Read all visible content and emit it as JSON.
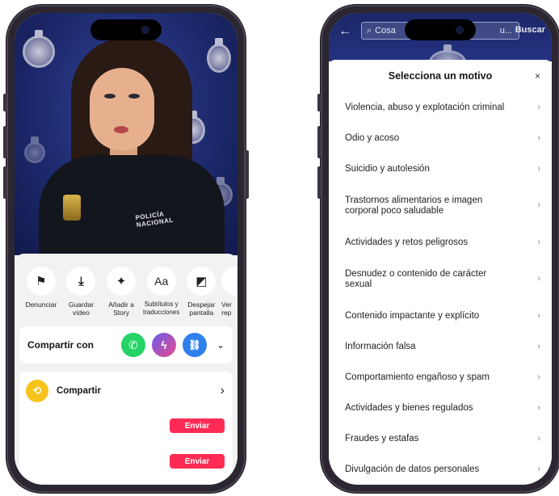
{
  "left_phone": {
    "video": {
      "uniform_text": "POLICÍA NACIONAL"
    },
    "actions": [
      {
        "icon": "flag-icon",
        "glyph": "⚑",
        "label": "Denunciar"
      },
      {
        "icon": "download-icon",
        "glyph": "⤓",
        "label": "Guardar\nvídeo"
      },
      {
        "icon": "sparkle-icon",
        "glyph": "✦",
        "label": "Añadir a\nStory"
      },
      {
        "icon": "captions-icon",
        "glyph": "Aa",
        "label": "Subtítulos y\ntraducciones"
      },
      {
        "icon": "clear-screen-icon",
        "glyph": "◩",
        "label": "Despejar\npantalla"
      },
      {
        "icon": "more-icon",
        "glyph": "",
        "label": "Ver\nrep"
      }
    ],
    "share": {
      "title": "Compartir con",
      "apps": [
        {
          "icon": "whatsapp-icon",
          "glyph": "✆",
          "color": "#25d366"
        },
        {
          "icon": "messenger-icon",
          "glyph": "ϟ",
          "color": "#c64fc8"
        },
        {
          "icon": "link-icon",
          "glyph": "🔗",
          "color": "#2f80ed"
        }
      ],
      "expand_glyph": "⌄"
    },
    "friends": {
      "compartir_label": "Compartir",
      "compartir_chevron": "›",
      "send_buttons": [
        "Enviar",
        "Enviar"
      ]
    }
  },
  "right_phone": {
    "search": {
      "value": "Cosa",
      "truncated": "u...",
      "button": "Buscar"
    },
    "modal": {
      "title": "Selecciona un motivo",
      "close": "×",
      "reasons": [
        "Violencia, abuso y explotación criminal",
        "Odio y acoso",
        "Suicidio y autolesión",
        "Trastornos alimentarios e imagen corporal poco saludable",
        "Actividades y retos peligrosos",
        "Desnudez o contenido de carácter sexual",
        "Contenido impactante y explícito",
        "Información falsa",
        "Comportamiento engañoso y spam",
        "Actividades y bienes regulados",
        "Fraudes y estafas",
        "Divulgación de datos personales"
      ]
    }
  },
  "colors": {
    "accent": "#fe2c55",
    "video_bg": "#1d2a6e",
    "repost": "#f7c31b"
  }
}
